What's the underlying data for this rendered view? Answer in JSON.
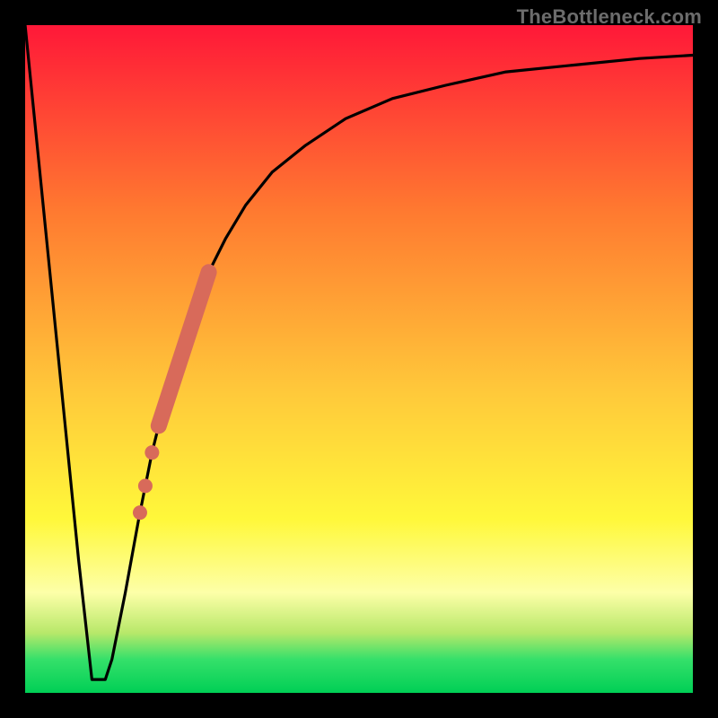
{
  "attribution": "TheBottleneck.com",
  "colors": {
    "top": "#ff1838",
    "mid1": "#ff7a30",
    "mid2": "#ffc93a",
    "mid3": "#fff83a",
    "pale": "#fdffa8",
    "green1": "#b8e86a",
    "green2": "#35e06a",
    "green3": "#00cf55",
    "frame": "#000000",
    "curve": "#000000",
    "dots": "#d86a5a"
  },
  "chart_data": {
    "type": "line",
    "title": "",
    "xlabel": "",
    "ylabel": "",
    "xlim": [
      0,
      100
    ],
    "ylim": [
      0,
      100
    ],
    "series": [
      {
        "name": "bottleneck-curve",
        "x": [
          0,
          4,
          8,
          10,
          11,
          12,
          13,
          15,
          17,
          19,
          21,
          23,
          25,
          27,
          30,
          33,
          37,
          42,
          48,
          55,
          63,
          72,
          82,
          92,
          100
        ],
        "y": [
          100,
          60,
          20,
          2,
          2,
          2,
          5,
          15,
          26,
          36,
          44,
          51,
          57,
          62,
          68,
          73,
          78,
          82,
          86,
          89,
          91,
          93,
          94,
          95,
          95.5
        ]
      }
    ],
    "highlight_segment": {
      "name": "thick-dot-band",
      "x": [
        20.0,
        27.5
      ],
      "y": [
        40.0,
        63.0
      ]
    },
    "highlight_dots": [
      {
        "x": 19.0,
        "y": 36.0
      },
      {
        "x": 18.0,
        "y": 31.0
      },
      {
        "x": 17.2,
        "y": 27.0
      }
    ]
  }
}
